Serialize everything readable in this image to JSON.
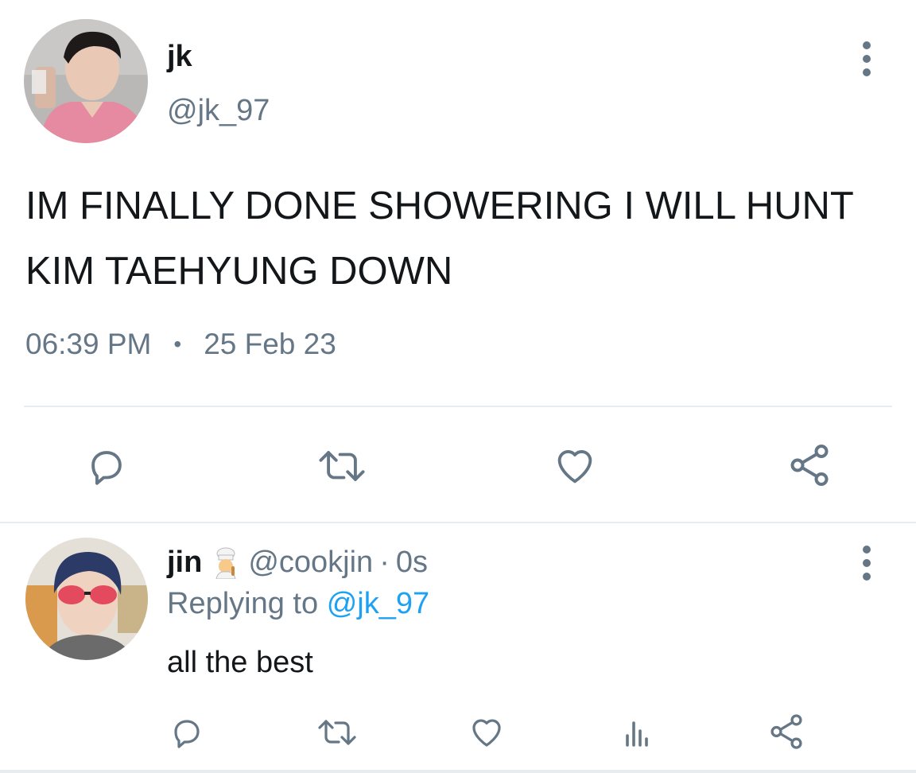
{
  "main_tweet": {
    "display_name": "jk",
    "handle": "@jk_97",
    "text": "IM FINALLY DONE SHOWERING I WILL HUNT KIM TAEHYUNG DOWN",
    "time": "06:39 PM",
    "separator": "•",
    "date": "25 Feb 23",
    "actions": [
      "reply-icon",
      "retweet-icon",
      "like-icon",
      "share-icon"
    ],
    "more_icon": "more-vertical-icon"
  },
  "reply_tweet": {
    "display_name": "jin",
    "emoji": "cook-emoji",
    "handle": "@cookjin",
    "separator": "·",
    "time": "0s",
    "replying_prefix": "Replying to",
    "replying_mention": "@jk_97",
    "text": "all the best",
    "actions": [
      "reply-icon",
      "retweet-icon",
      "like-icon",
      "analytics-icon",
      "share-icon"
    ],
    "more_icon": "more-vertical-icon"
  },
  "colors": {
    "text": "#14171a",
    "secondary": "#657786",
    "mention": "#1da1f2",
    "divider": "#e6ecf0",
    "icon": "#657786"
  }
}
